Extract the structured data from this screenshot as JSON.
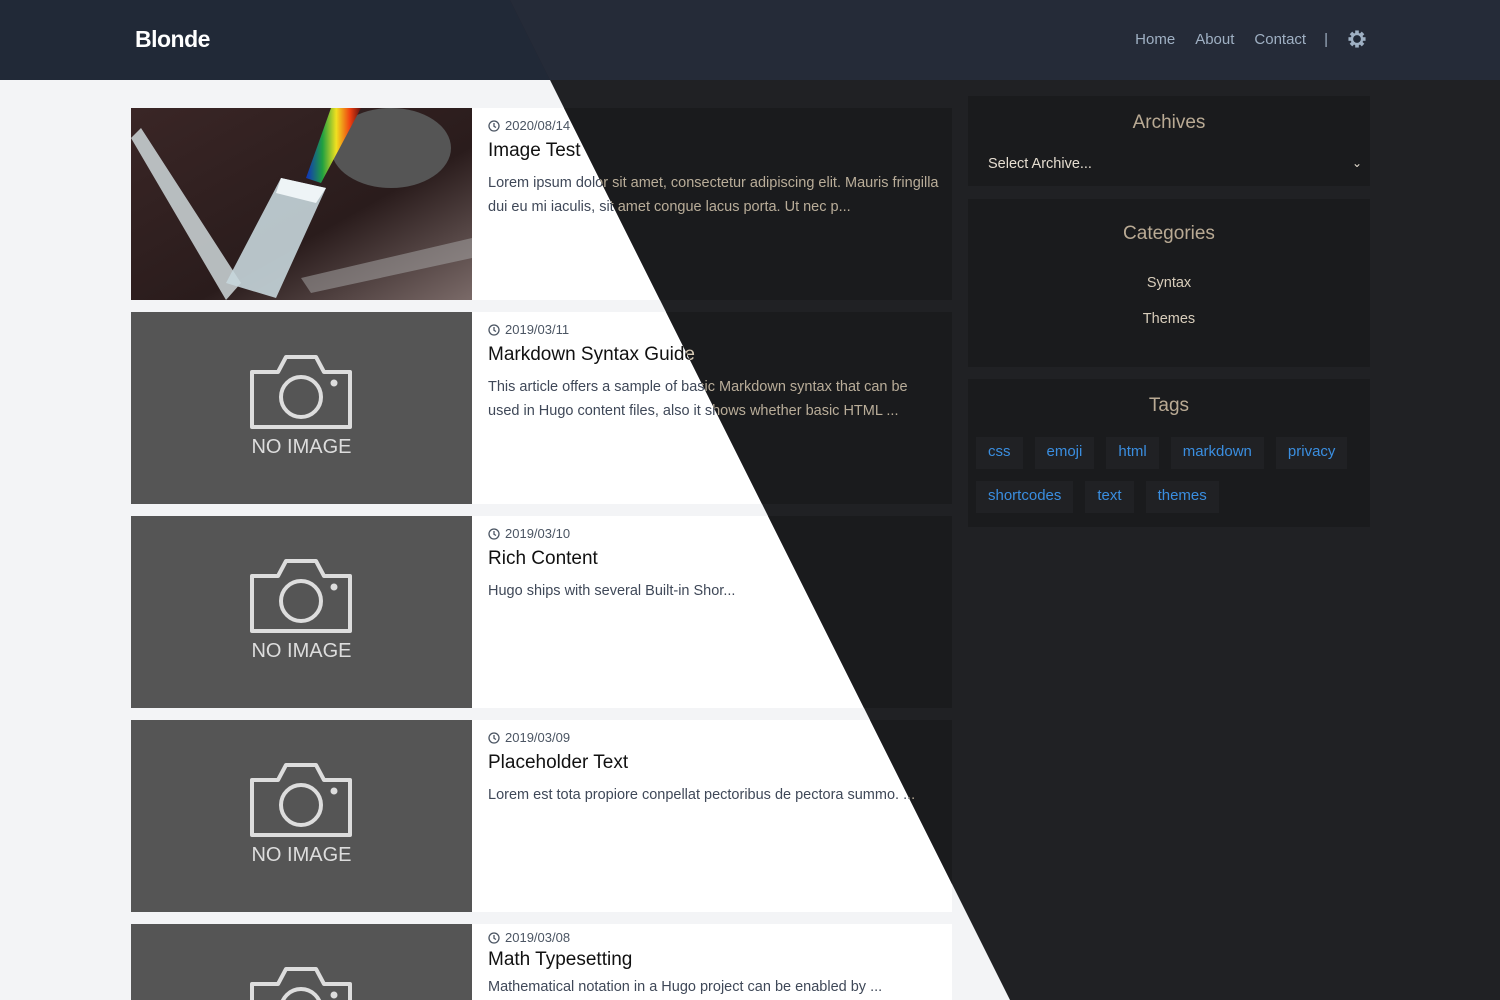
{
  "header": {
    "brand": "Blonde",
    "nav": [
      "Home",
      "About",
      "Contact"
    ],
    "separator": "|",
    "theme_toggle_icon": "gear-icon"
  },
  "posts": [
    {
      "date": "2020/08/14",
      "title": "Image Test",
      "excerpt": "Lorem ipsum dolor sit amet, consectetur adipiscing elit. Mauris fringilla dui eu mi iaculis, sit amet congue lacus porta. Ut nec p...",
      "image": "prism-photo"
    },
    {
      "date": "2019/03/11",
      "title": "Markdown Syntax Guide",
      "excerpt": "This article offers a sample of basic Markdown syntax that can be used in Hugo content files, also it shows whether basic HTML ...",
      "image": "no-image"
    },
    {
      "date": "2019/03/10",
      "title": "Rich Content",
      "excerpt": "Hugo ships with several Built-in Shor...",
      "image": "no-image"
    },
    {
      "date": "2019/03/09",
      "title": "Placeholder Text",
      "excerpt": "Lorem est tota propiore conpellat pectoribus de pectora summo. ...",
      "image": "no-image"
    },
    {
      "date": "2019/03/08",
      "title": "Math Typesetting",
      "excerpt": "Mathematical notation in a Hugo project can be enabled by ...",
      "image": "no-image"
    }
  ],
  "no_image_label": "NO IMAGE",
  "sidebar": {
    "archives": {
      "title": "Archives",
      "select_value": "Select Archive..."
    },
    "categories": {
      "title": "Categories",
      "items": [
        "Syntax",
        "Themes"
      ]
    },
    "tags": {
      "title": "Tags",
      "items": [
        "css",
        "emoji",
        "html",
        "markdown",
        "privacy",
        "shortcodes",
        "text",
        "themes"
      ]
    }
  },
  "colors": {
    "header": "#212937",
    "tag_link": "#3a8ee0",
    "dark_bg": "#202124",
    "light_bg": "#f3f4f6"
  }
}
